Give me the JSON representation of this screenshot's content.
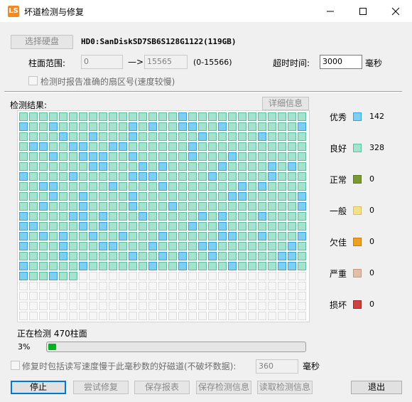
{
  "window": {
    "title": "坏道检测与修复",
    "icon_text": "LS"
  },
  "disk": {
    "select_label": "选择硬盘",
    "name": "HD0:SanDiskSD7SB6S128G1122(119GB)"
  },
  "cylinder_range": {
    "label": "柱面范围:",
    "start": "0",
    "arrow": "—>",
    "end": "15565",
    "range_hint": "(0-15566)"
  },
  "timeout": {
    "label": "超时时间:",
    "value": "3000",
    "unit": "毫秒"
  },
  "report_sector_option": {
    "label": "检测时报告准确的扇区号(速度较慢)",
    "checked": false
  },
  "results": {
    "label": "检测结果:",
    "details_label": "详细信息"
  },
  "grid": {
    "columns": 29,
    "rows": 21,
    "filled_cells": 470,
    "excellent_columns_by_row": [
      [
        16
      ],
      [
        0,
        3,
        11,
        13,
        16,
        17,
        20,
        28
      ],
      [
        4,
        7,
        11,
        18,
        24
      ],
      [
        1,
        2,
        5,
        6,
        9,
        10,
        17
      ],
      [
        3,
        6,
        7,
        8,
        11,
        17,
        21
      ],
      [
        7,
        8,
        12,
        14,
        20,
        25,
        27
      ],
      [
        0,
        5,
        11,
        12,
        13,
        19,
        25
      ],
      [
        2,
        3,
        9,
        14,
        22,
        24
      ],
      [
        3,
        6,
        11,
        21,
        22,
        28
      ],
      [
        2,
        6,
        11,
        15,
        28
      ],
      [
        0,
        5,
        6,
        8,
        12,
        18,
        20,
        24
      ],
      [
        0,
        1,
        6,
        8,
        17,
        20
      ],
      [
        0,
        2,
        4,
        7,
        10,
        14,
        20,
        21,
        24,
        28
      ],
      [
        0,
        4,
        8,
        9,
        13,
        18,
        19,
        27
      ],
      [
        4,
        11,
        14,
        16,
        19,
        26,
        27
      ],
      [
        0,
        6,
        13,
        16,
        21,
        26,
        27
      ],
      [
        0,
        3
      ]
    ]
  },
  "legend": [
    {
      "label": "优秀",
      "count": "142",
      "color": "#7fd0f0",
      "border": "#2fa6df"
    },
    {
      "label": "良好",
      "count": "328",
      "color": "#a6e3cf",
      "border": "#5bbfa0"
    },
    {
      "label": "正常",
      "count": "0",
      "color": "#7a9a30",
      "border": "#5f7a22"
    },
    {
      "label": "一般",
      "count": "0",
      "color": "#f3e08a",
      "border": "#d8c160"
    },
    {
      "label": "欠佳",
      "count": "0",
      "color": "#f0a020",
      "border": "#c87d0e"
    },
    {
      "label": "严重",
      "count": "0",
      "color": "#e2c0a8",
      "border": "#c49a7e"
    },
    {
      "label": "损坏",
      "count": "0",
      "color": "#cf4040",
      "border": "#a02828"
    }
  ],
  "status": {
    "text": "正在检测 470柱面",
    "percent_label": "3%",
    "progress_fraction": 0.03
  },
  "repair_option": {
    "label": "修复时包括读写速度慢于此毫秒数的好磁道(不破坏数据):",
    "value": "360",
    "unit": "毫秒"
  },
  "buttons": {
    "stop": "停止",
    "try_repair": "尝试修复",
    "save_report": "保存报表",
    "save_info": "保存检测信息",
    "read_info": "读取检测信息",
    "exit": "退出"
  },
  "colors": {
    "empty_cell": "#f6f6f6",
    "empty_cell_border": "#dadada",
    "progress_fill": "#06b025"
  }
}
